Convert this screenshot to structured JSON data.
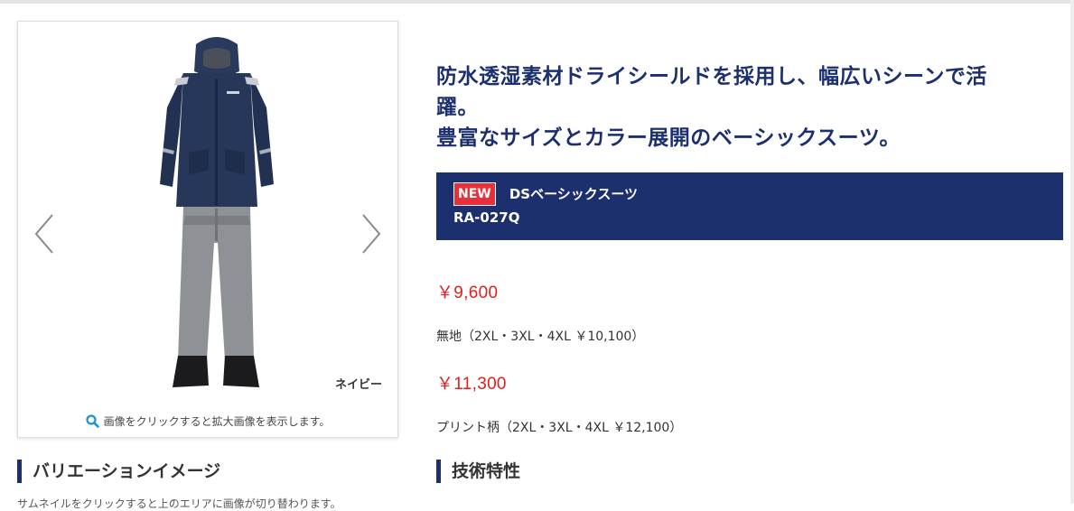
{
  "product_image": {
    "color_label": "ネイビー",
    "zoom_hint": "画像をクリックすると拡大画像を表示します。",
    "icons": {
      "prev": "chevron-left-icon",
      "next": "chevron-right-icon",
      "zoom": "search-icon"
    }
  },
  "variation": {
    "heading": "バリエーションイメージ",
    "note": "サムネイルをクリックすると上のエリアに画像が切り替わります。"
  },
  "catchcopy": {
    "line1": "防水透湿素材ドライシールドを採用し、幅広いシーンで活",
    "line2": "躍。",
    "line3": "豊富なサイズとカラー展開のベーシックスーツ。"
  },
  "product": {
    "badge": "NEW",
    "name": "DSベーシックスーツ",
    "code": "RA-027Q"
  },
  "prices": [
    {
      "price": "￥9,600",
      "note": "無地（2XL・3XL・4XL ￥10,100）"
    },
    {
      "price": "￥11,300",
      "note": "プリント柄（2XL・3XL・4XL ￥12,100）"
    }
  ],
  "tech": {
    "heading": "技術特性"
  },
  "colors": {
    "brand_navy": "#1c2f6e",
    "price_red": "#e02020",
    "badge_red": "#e8303a"
  }
}
